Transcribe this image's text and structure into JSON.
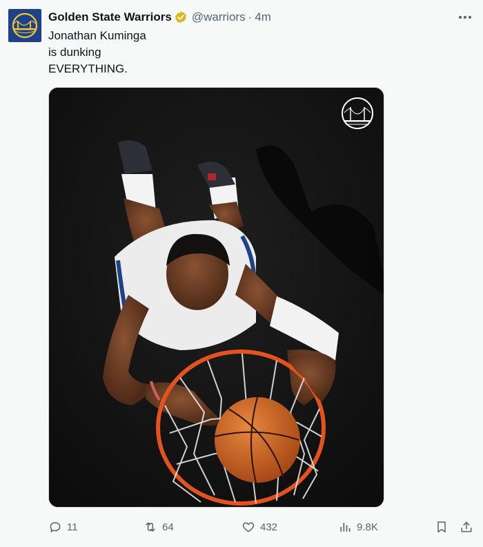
{
  "tweet": {
    "author_name": "Golden State Warriors",
    "handle": "@warriors",
    "separator": "·",
    "time": "4m",
    "verified": true,
    "text_lines": [
      "Jonathan Kuminga",
      "is dunking",
      "EVERYTHING."
    ],
    "image_overlay_icon": "bridge-logo-icon"
  },
  "actions": {
    "reply_count": "11",
    "retweet_count": "64",
    "like_count": "432",
    "views_count": "9.8K"
  },
  "colors": {
    "brand_blue": "#1d428a",
    "brand_gold": "#ffc72c",
    "verified_gold": "#e2b719",
    "muted_text": "#536471",
    "background": "#f7f9f9"
  }
}
